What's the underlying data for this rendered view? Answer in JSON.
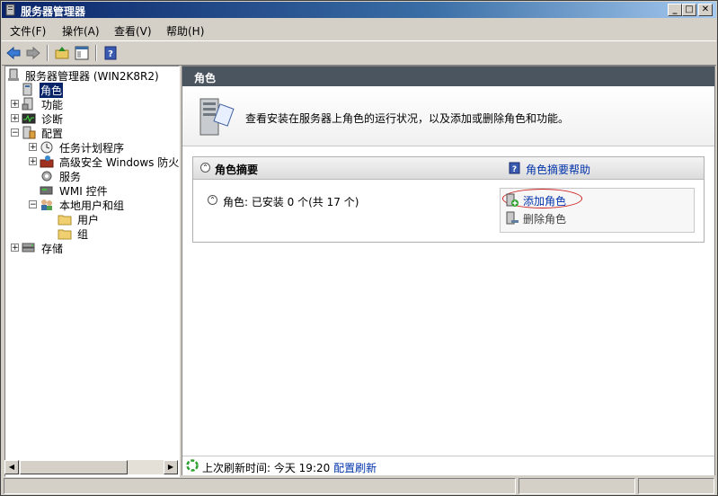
{
  "window": {
    "title": "服务器管理器"
  },
  "menu": [
    {
      "label": "文件(F)"
    },
    {
      "label": "操作(A)"
    },
    {
      "label": "查看(V)"
    },
    {
      "label": "帮助(H)"
    }
  ],
  "tree": {
    "root": "服务器管理器 (WIN2K8R2)",
    "roles": "角色",
    "features": "功能",
    "diagnostics": "诊断",
    "configuration": "配置",
    "task_scheduler": "任务计划程序",
    "firewall": "高级安全 Windows 防火墙",
    "services": "服务",
    "wmi": "WMI 控件",
    "local_users": "本地用户和组",
    "users": "用户",
    "groups": "组",
    "storage": "存储"
  },
  "right": {
    "header": "角色",
    "banner_text": "查看安装在服务器上角色的运行状况，以及添加或删除角色和功能。",
    "summary_title": "角色摘要",
    "summary_help": "角色摘要帮助",
    "roles_status": "角色: 已安装 0 个(共 17 个)",
    "add_roles": "添加角色",
    "remove_roles": "删除角色",
    "footer_label": "上次刷新时间: 今天 19:20",
    "footer_link": "配置刷新"
  },
  "colors": {
    "selection": "#0a246a",
    "link": "#0033aa",
    "header_bg": "#4a5560",
    "highlight_oval": "#cc2020"
  }
}
